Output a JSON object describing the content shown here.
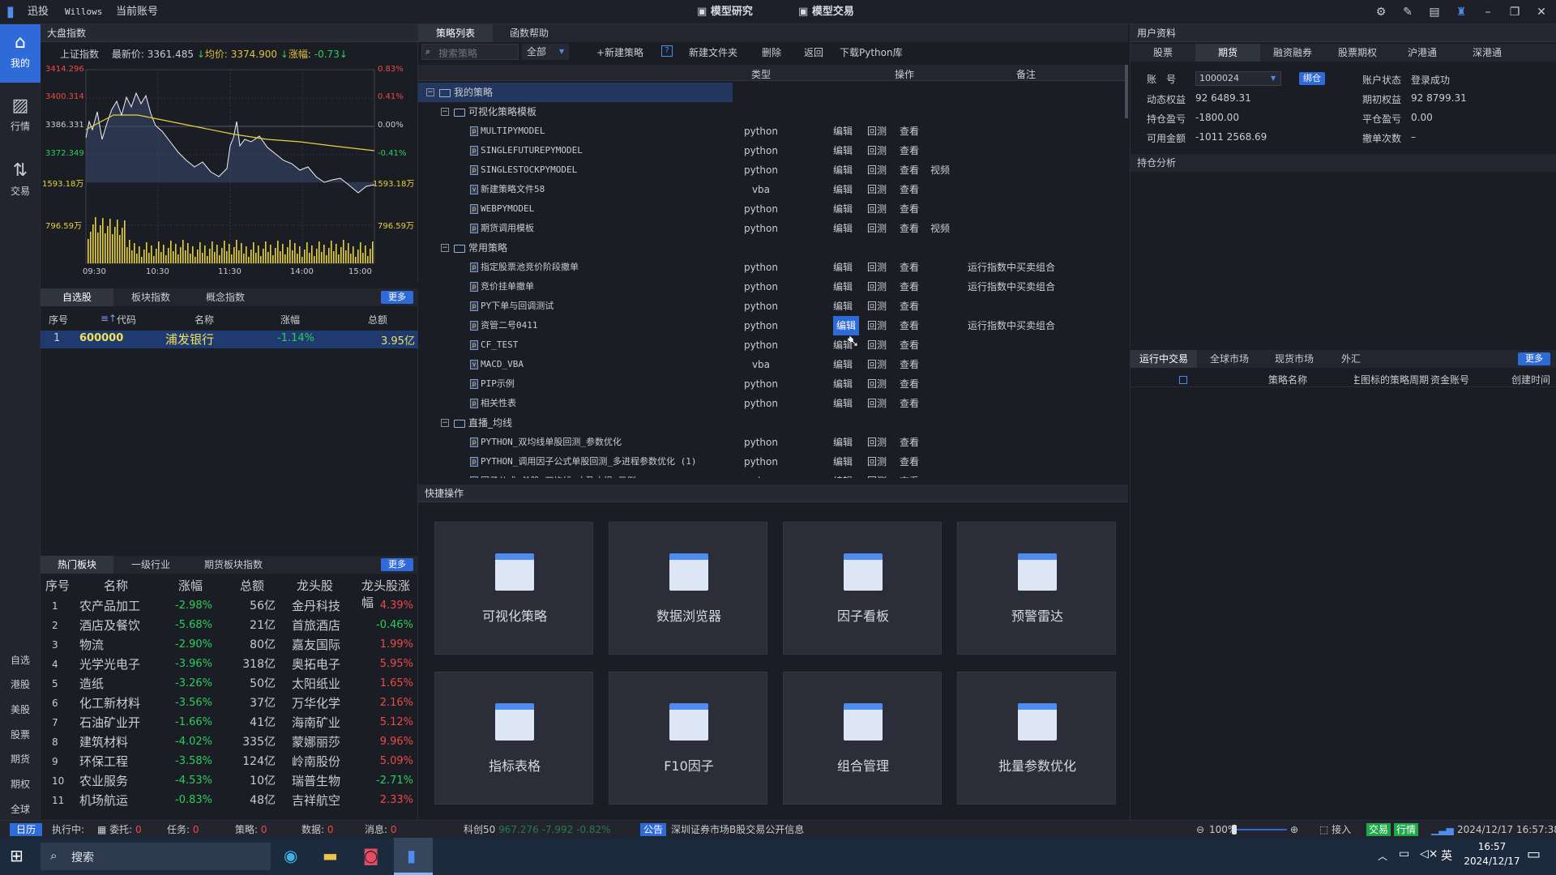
{
  "titlebar": {
    "app_name": "迅投",
    "user": "Willows",
    "account_label": "当前账号",
    "nav_research": "模型研究",
    "nav_trade": "模型交易"
  },
  "leftnav": {
    "items": [
      {
        "label": "我的",
        "icon": "home-icon"
      },
      {
        "label": "行情",
        "icon": "chart-icon"
      },
      {
        "label": "交易",
        "icon": "trade-icon"
      }
    ],
    "bottom": [
      "自选",
      "港股",
      "美股",
      "股票",
      "期货",
      "期权",
      "全球"
    ]
  },
  "market": {
    "header": "大盘指数",
    "index_name": "上证指数",
    "latest_label": "最新价:",
    "latest": "3361.485",
    "avg_label": "均价:",
    "avg": "3374.900",
    "chg_label": "涨幅:",
    "chg": "-0.73",
    "price_ticks": [
      "3414.296",
      "3400.314",
      "3386.331",
      "3372.349",
      "1593.18万",
      "796.59万"
    ],
    "pct_ticks": [
      "0.83%",
      "0.41%",
      "0.00%",
      "-0.41%",
      "1593.18万",
      "796.59万"
    ],
    "time_ticks": [
      "09:30",
      "10:30",
      "11:30",
      "14:00",
      "15:00"
    ]
  },
  "watchlist": {
    "tabs": [
      "自选股",
      "板块指数",
      "概念指数"
    ],
    "more": "更多",
    "headers": [
      "序号",
      "代码",
      "名称",
      "涨幅",
      "总额"
    ],
    "rows": [
      {
        "idx": "1",
        "code": "600000",
        "name": "浦发银行",
        "chg": "-1.14%",
        "amt": "3.95亿"
      }
    ]
  },
  "sectors": {
    "tabs": [
      "热门板块",
      "一级行业",
      "期货板块指数"
    ],
    "more": "更多",
    "headers": [
      "序号",
      "名称",
      "涨幅",
      "总额",
      "龙头股",
      "龙头股涨幅"
    ],
    "rows": [
      {
        "idx": "1",
        "name": "农产品加工",
        "chg": "-2.98%",
        "amt": "56亿",
        "lead": "金丹科技",
        "lchg": "4.39%"
      },
      {
        "idx": "2",
        "name": "酒店及餐饮",
        "chg": "-5.68%",
        "amt": "21亿",
        "lead": "首旅酒店",
        "lchg": "-0.46%"
      },
      {
        "idx": "3",
        "name": "物流",
        "chg": "-2.90%",
        "amt": "80亿",
        "lead": "嘉友国际",
        "lchg": "1.99%"
      },
      {
        "idx": "4",
        "name": "光学光电子",
        "chg": "-3.96%",
        "amt": "318亿",
        "lead": "奥拓电子",
        "lchg": "5.95%"
      },
      {
        "idx": "5",
        "name": "造纸",
        "chg": "-3.26%",
        "amt": "50亿",
        "lead": "太阳纸业",
        "lchg": "1.65%"
      },
      {
        "idx": "6",
        "name": "化工新材料",
        "chg": "-3.56%",
        "amt": "37亿",
        "lead": "万华化学",
        "lchg": "2.16%"
      },
      {
        "idx": "7",
        "name": "石油矿业开",
        "chg": "-1.66%",
        "amt": "41亿",
        "lead": "海南矿业",
        "lchg": "5.12%"
      },
      {
        "idx": "8",
        "name": "建筑材料",
        "chg": "-4.02%",
        "amt": "335亿",
        "lead": "蒙娜丽莎",
        "lchg": "9.96%"
      },
      {
        "idx": "9",
        "name": "环保工程",
        "chg": "-3.58%",
        "amt": "124亿",
        "lead": "岭南股份",
        "lchg": "5.09%"
      },
      {
        "idx": "10",
        "name": "农业服务",
        "chg": "-4.53%",
        "amt": "10亿",
        "lead": "瑞普生物",
        "lchg": "-2.71%"
      },
      {
        "idx": "11",
        "name": "机场航运",
        "chg": "-0.83%",
        "amt": "48亿",
        "lead": "吉祥航空",
        "lchg": "2.33%"
      }
    ]
  },
  "strategy": {
    "tabs": [
      "策略列表",
      "函数帮助"
    ],
    "search_placeholder": "搜索策略",
    "filter": "全部",
    "toolbar": [
      "+新建策略",
      "新建文件夹",
      "删除",
      "返回",
      "下载Python库"
    ],
    "help": "?",
    "col_type": "类型",
    "col_op": "操作",
    "col_note": "备注",
    "op_edit": "编辑",
    "op_back": "回测",
    "op_view": "查看",
    "op_video": "视频",
    "tree": [
      {
        "kind": "folder",
        "level": 0,
        "name": "我的策略",
        "sel": true
      },
      {
        "kind": "folder",
        "level": 1,
        "name": "可视化策略模板"
      },
      {
        "kind": "file",
        "name": "MULTIPYMODEL",
        "type": "python",
        "ft": "p"
      },
      {
        "kind": "file",
        "name": "SINGLEFUTUREPYMODEL",
        "type": "python",
        "ft": "p"
      },
      {
        "kind": "file",
        "name": "SINGLESTOCKPYMODEL",
        "type": "python",
        "ft": "p",
        "video": true
      },
      {
        "kind": "file",
        "name": "新建策略文件58",
        "type": "vba",
        "ft": "v"
      },
      {
        "kind": "file",
        "name": "WEBPYMODEL",
        "type": "python",
        "ft": "p"
      },
      {
        "kind": "file",
        "name": "期货调用模板",
        "type": "python",
        "ft": "p",
        "video": true
      },
      {
        "kind": "folder",
        "level": 1,
        "name": "常用策略"
      },
      {
        "kind": "file",
        "name": "指定股票池竞价阶段撤单",
        "type": "python",
        "ft": "p",
        "note": "运行指数中买卖组合"
      },
      {
        "kind": "file",
        "name": "竞价挂单撤单",
        "type": "python",
        "ft": "p",
        "note": "运行指数中买卖组合"
      },
      {
        "kind": "file",
        "name": "PY下单与回调测试",
        "type": "python",
        "ft": "p"
      },
      {
        "kind": "file",
        "name": "资管二号0411",
        "type": "python",
        "ft": "p",
        "note": "运行指数中买卖组合",
        "hl": true
      },
      {
        "kind": "file",
        "name": "CF_TEST",
        "type": "python",
        "ft": "p"
      },
      {
        "kind": "file",
        "name": "MACD_VBA",
        "type": "vba",
        "ft": "v"
      },
      {
        "kind": "file",
        "name": "PIP示例",
        "type": "python",
        "ft": "p"
      },
      {
        "kind": "file",
        "name": "相关性表",
        "type": "python",
        "ft": "p"
      },
      {
        "kind": "folder",
        "level": 1,
        "name": "直播_均线"
      },
      {
        "kind": "file",
        "name": "PYTHON_双均线单股回测_参数优化",
        "type": "python",
        "ft": "p"
      },
      {
        "kind": "file",
        "name": "PYTHON_调用因子公式单股回测_多进程参数优化 (1)",
        "type": "python",
        "ft": "p"
      },
      {
        "kind": "file",
        "name": "因子公式_单股_双均线_止盈止损_示例",
        "type": "vba",
        "ft": "v"
      }
    ]
  },
  "quick": {
    "header": "快捷操作",
    "cards": [
      {
        "label": "可视化策略",
        "icon": "visual-strategy-icon"
      },
      {
        "label": "数据浏览器",
        "icon": "data-browser-icon"
      },
      {
        "label": "因子看板",
        "icon": "factor-board-icon"
      },
      {
        "label": "预警雷达",
        "icon": "alert-radar-icon"
      },
      {
        "label": "指标表格",
        "icon": "indicator-table-icon"
      },
      {
        "label": "F10因子",
        "icon": "f10-factor-icon"
      },
      {
        "label": "组合管理",
        "icon": "portfolio-icon"
      },
      {
        "label": "批量参数优化",
        "icon": "batch-optimize-icon"
      }
    ]
  },
  "user": {
    "header": "用户资料",
    "tabs": [
      "股票",
      "期货",
      "融资融券",
      "股票期权",
      "沪港通",
      "深港通"
    ],
    "account_label": "账　号",
    "account": "1000024",
    "bind": "绑仓",
    "status_label": "账户状态",
    "status": "登录成功",
    "fields": [
      {
        "l": "动态权益",
        "v": "92 6489.31",
        "l2": "期初权益",
        "v2": "92 8799.31"
      },
      {
        "l": "持仓盈亏",
        "v": "-1800.00",
        "l2": "平仓盈亏",
        "v2": "0.00"
      },
      {
        "l": "可用金额",
        "v": "-1011 2568.69",
        "l2": "撤单次数",
        "v2": "–"
      }
    ],
    "position_header": "持仓分析"
  },
  "running": {
    "tabs": [
      "运行中交易",
      "全球市场",
      "现货市场",
      "外汇"
    ],
    "more": "更多",
    "headers": [
      "策略名称",
      "主图标的策略周期",
      "资金账号",
      "创建时间"
    ]
  },
  "statusbar": {
    "calendar": "日历",
    "exec": "执行中:",
    "entrust": "委托:",
    "entrust_n": "0",
    "task": "任务:",
    "task_n": "0",
    "strategy": "策略:",
    "strategy_n": "0",
    "data": "数据:",
    "data_n": "0",
    "msg": "消息:",
    "msg_n": "0",
    "kc50": "科创50",
    "kc_val": "967.276",
    "kc_chg": "-7.992",
    "kc_pct": "-0.82%",
    "notice": "公告",
    "notice_text": "深圳证券市场B股交易公开信息",
    "zoom": "100%",
    "connect": "接入",
    "trade": "交易",
    "quote": "行情",
    "datetime": "2024/12/17 16:57:38"
  },
  "taskbar": {
    "search": "搜索",
    "time": "16:57",
    "date": "2024/12/17",
    "ime": "英"
  }
}
